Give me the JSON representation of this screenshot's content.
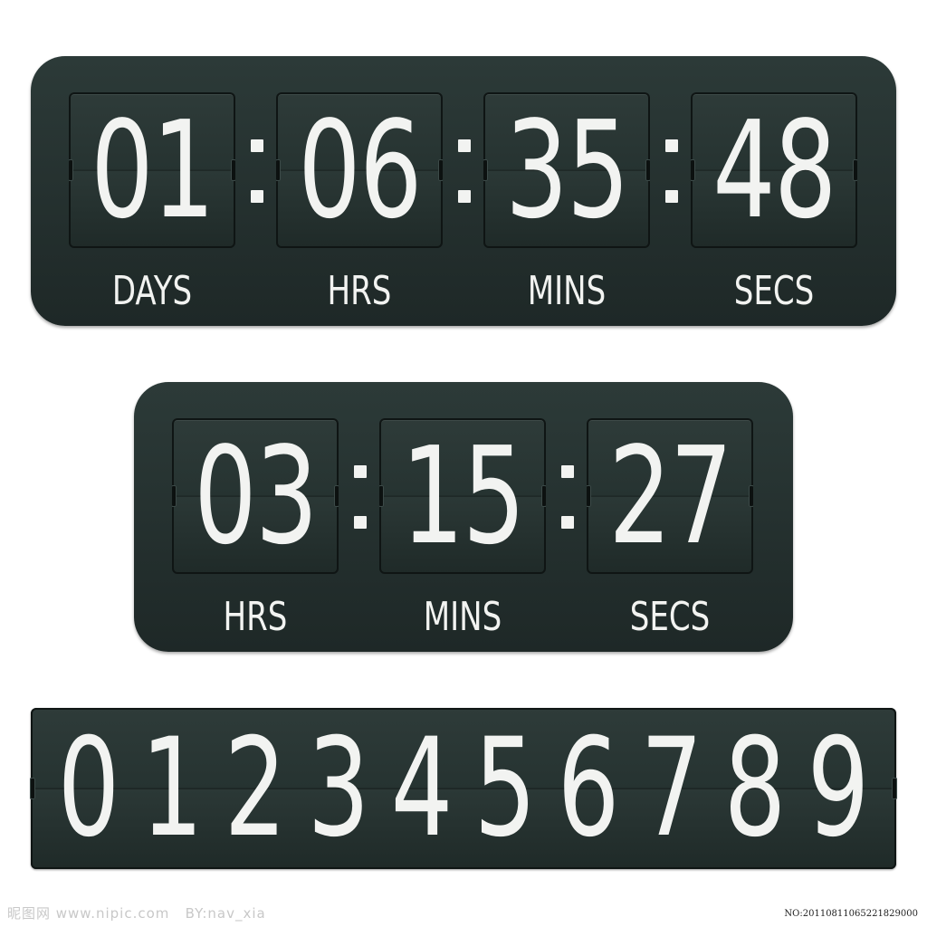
{
  "countdown_days": {
    "units": [
      {
        "value": "01",
        "label": "DAYS"
      },
      {
        "value": "06",
        "label": "HRS"
      },
      {
        "value": "35",
        "label": "MINS"
      },
      {
        "value": "48",
        "label": "SECS"
      }
    ],
    "separator": ":"
  },
  "countdown_hours": {
    "units": [
      {
        "value": "03",
        "label": "HRS"
      },
      {
        "value": "15",
        "label": "MINS"
      },
      {
        "value": "27",
        "label": "SECS"
      }
    ],
    "separator": ":"
  },
  "digit_strip": {
    "digits": [
      "0",
      "1",
      "2",
      "3",
      "4",
      "5",
      "6",
      "7",
      "8",
      "9"
    ]
  },
  "watermark": {
    "left": "昵图网 www.nipic.com   BY:nav_xia",
    "right": "NO:20110811065221829000"
  },
  "colors": {
    "panel": "#263331",
    "digit": "#f2f3f1",
    "background": "#ffffff"
  }
}
